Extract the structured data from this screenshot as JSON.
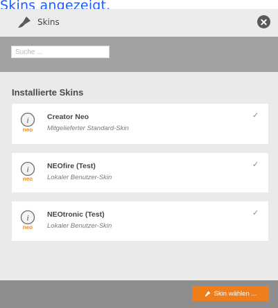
{
  "background": {
    "link_text": "Skins angezeigt."
  },
  "dialog": {
    "title": "Skins",
    "icons": {
      "title_icon": "paint-brush-icon",
      "close_icon": "close-icon"
    }
  },
  "search": {
    "placeholder": "Suche ...",
    "value": ""
  },
  "section_title": "Installierte Skins",
  "skins": [
    {
      "name": "Creator Neo",
      "description": "Mitgelieferter Standard-Skin",
      "logo_text": "neo",
      "selected": true
    },
    {
      "name": "NEOfire (Test)",
      "description": "Lokaler Benutzer-Skin",
      "logo_text": "neo",
      "selected": true
    },
    {
      "name": "NEOtronic (Test)",
      "description": "Lokaler Benutzer-Skin",
      "logo_text": "neo",
      "selected": true
    }
  ],
  "check_glyph": "✓",
  "footer": {
    "choose_label": "Skin wählen ..."
  },
  "colors": {
    "link": "#1a5cff",
    "accent_button": "#ef7d19",
    "search_bar": "#a2a2a2",
    "footer_bar": "#8e8e8e",
    "dialog_bg": "#eaeaea",
    "logo_orange": "#f08a1c"
  }
}
